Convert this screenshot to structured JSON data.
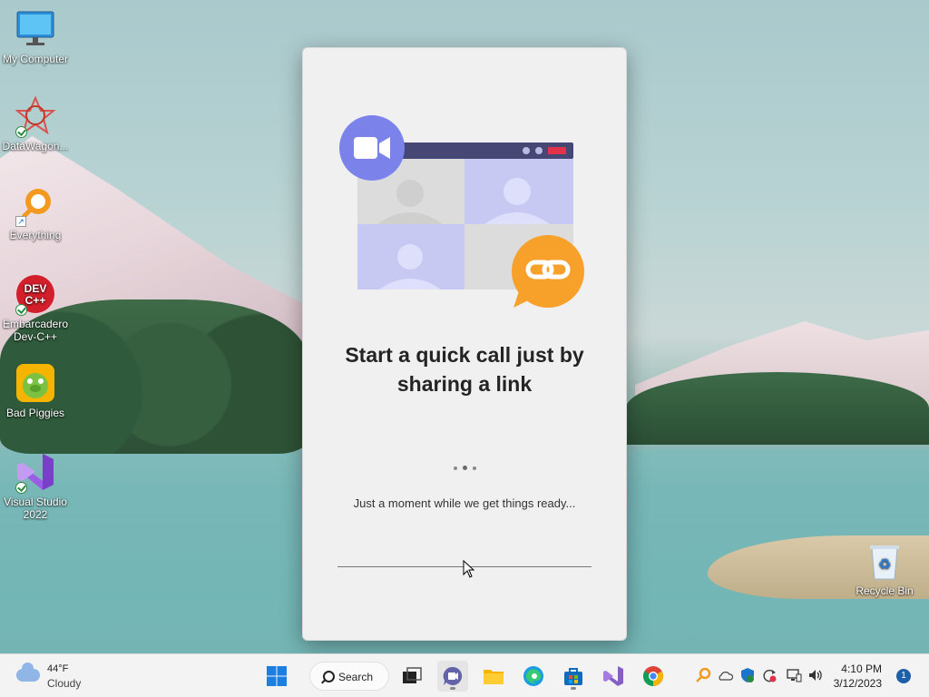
{
  "desktop": {
    "icons": [
      {
        "label": "My Computer"
      },
      {
        "label": "DataWagon..."
      },
      {
        "label": "Everything"
      },
      {
        "label": "Embarcadero Dev-C++"
      },
      {
        "label": "Bad Piggies"
      },
      {
        "label": "Visual Studio 2022"
      },
      {
        "label": "Recycle Bin"
      }
    ]
  },
  "dialog": {
    "headline": "Start a quick call just by sharing a link",
    "loading_text": "Just a moment while we get things ready..."
  },
  "taskbar": {
    "weather": {
      "temp": "44°F",
      "condition": "Cloudy"
    },
    "search_label": "Search",
    "clock": {
      "time": "4:10 PM",
      "date": "3/12/2023"
    },
    "notification_count": "1"
  },
  "colors": {
    "teams_purple": "#7b83eb",
    "link_orange": "#f7a02a",
    "taskbar_bg": "#f3f3f3"
  }
}
